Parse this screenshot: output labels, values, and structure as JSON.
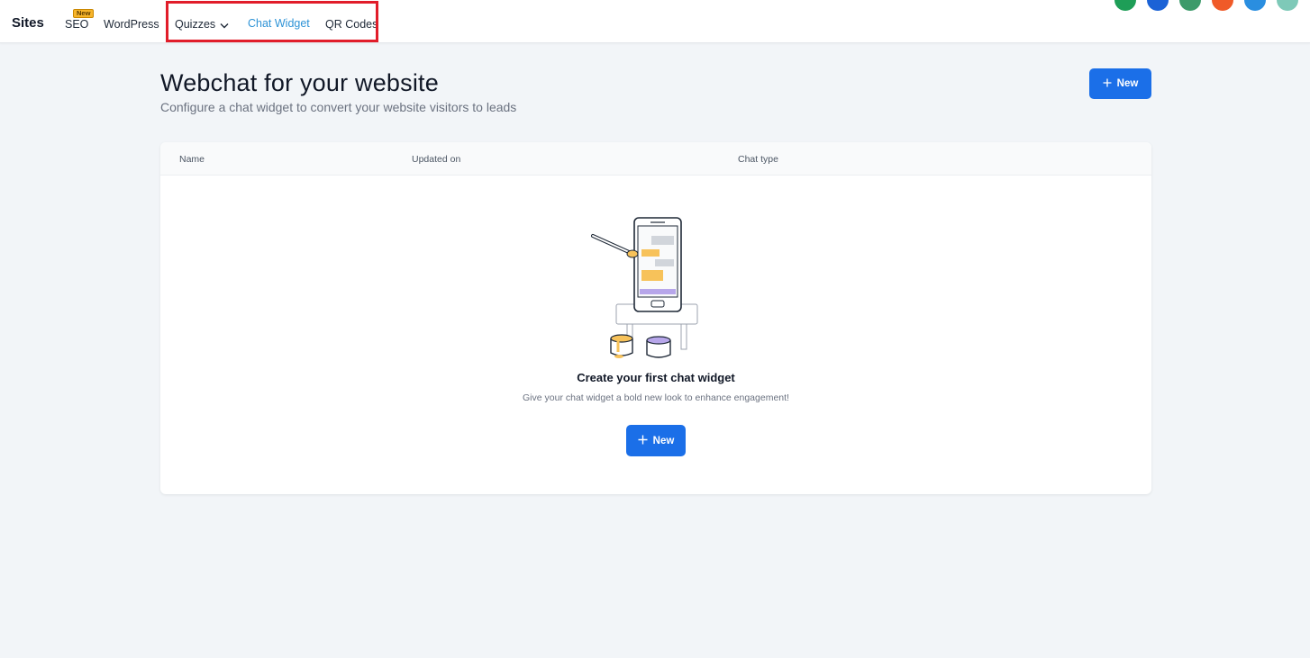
{
  "nav": {
    "brand": "Sites",
    "items": [
      {
        "label": "SEO",
        "badge": "New"
      },
      {
        "label": "WordPress"
      },
      {
        "label": "Quizzes",
        "icon": "chevron-down-icon"
      },
      {
        "label": "Chat Widget",
        "active": true
      },
      {
        "label": "QR Codes"
      }
    ],
    "avatars": [
      "#1e9e57",
      "#1b62d6",
      "#3c9a6a",
      "#f05a28",
      "#2a8ee0",
      "#7ec9b8"
    ]
  },
  "header": {
    "title": "Webchat for your website",
    "subtitle": "Configure a chat widget to convert your website visitors to leads",
    "new_button": "New"
  },
  "table": {
    "columns": [
      "Name",
      "Updated on",
      "Chat type"
    ],
    "empty_state": {
      "title": "Create your first chat widget",
      "subtitle": "Give your chat widget a bold new look to enhance engagement!",
      "button": "New"
    }
  },
  "colors": {
    "primary": "#1b6fe8",
    "active_tab": "#2e93d6",
    "badge": "#f7b52b",
    "highlight": "#e11d2a"
  }
}
